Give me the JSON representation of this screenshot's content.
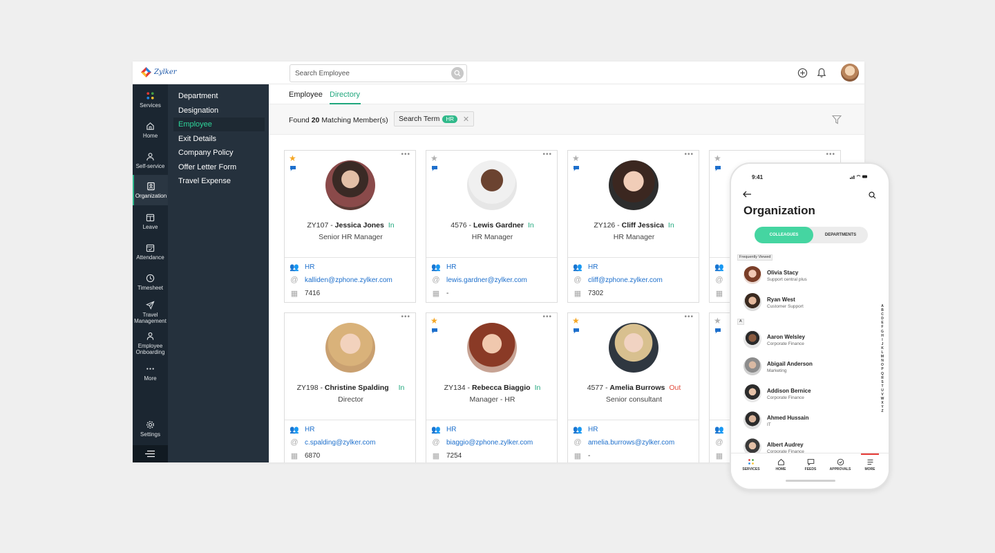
{
  "app": {
    "logo_text": "Zylker"
  },
  "search": {
    "placeholder": "Search Employee"
  },
  "rail": {
    "items": [
      {
        "label": "Services"
      },
      {
        "label": "Home"
      },
      {
        "label": "Self-service"
      },
      {
        "label": "Organization"
      },
      {
        "label": "Leave"
      },
      {
        "label": "Attendance"
      },
      {
        "label": "Timesheet"
      },
      {
        "label": "Travel Management"
      },
      {
        "label": "Employee Onboarding"
      },
      {
        "label": "More"
      },
      {
        "label": "Settings"
      }
    ]
  },
  "submenu": {
    "items": [
      {
        "label": "Department"
      },
      {
        "label": "Designation"
      },
      {
        "label": "Employee"
      },
      {
        "label": "Exit Details"
      },
      {
        "label": "Company Policy"
      },
      {
        "label": "Offer Letter Form"
      },
      {
        "label": "Travel Expense"
      }
    ]
  },
  "tabs": [
    {
      "label": "Employee"
    },
    {
      "label": "Directory"
    }
  ],
  "filter": {
    "found_prefix": "Found",
    "found_count": "20",
    "found_suffix": "Matching Member(s)",
    "chip_label": "Search Term",
    "chip_value": "HR"
  },
  "colors": {
    "accent": "#20a77d",
    "link": "#1d6fcc",
    "sidebar": "#1b2631",
    "submenu": "#25313d",
    "out": "#e24c3c",
    "star": "#f5a623"
  },
  "cards": [
    {
      "id": "ZY107",
      "name": "Jessica Jones",
      "status": "In",
      "role": "Senior HR Manager",
      "dept": "HR",
      "email": "kalliden@zphone.zylker.com",
      "ext": "7416",
      "starred": true
    },
    {
      "id": "4576",
      "name": "Lewis Gardner",
      "status": "In",
      "role": "HR Manager",
      "dept": "HR",
      "email": "lewis.gardner@zylker.com",
      "ext": "-",
      "starred": false
    },
    {
      "id": "ZY126",
      "name": "Cliff Jessica",
      "status": "In",
      "role": "HR Manager",
      "dept": "HR",
      "email": "cliff@zphone.zylker.com",
      "ext": "7302",
      "starred": false
    },
    {
      "id": "",
      "name": "",
      "status": "",
      "role": "",
      "dept": "",
      "email": "",
      "ext": "",
      "starred": false
    },
    {
      "id": "ZY198",
      "name": "Christine Spalding",
      "status": "In",
      "role": "Director",
      "dept": "HR",
      "email": "c.spalding@zylker.com",
      "ext": "6870",
      "starred": false
    },
    {
      "id": "ZY134",
      "name": "Rebecca Biaggio",
      "status": "In",
      "role": "Manager - HR",
      "dept": "HR",
      "email": "biaggio@zphone.zylker.com",
      "ext": "7254",
      "starred": true
    },
    {
      "id": "4577",
      "name": "Amelia Burrows",
      "status": "Out",
      "role": "Senior consultant",
      "dept": "HR",
      "email": "amelia.burrows@zylker.com",
      "ext": "-",
      "starred": true
    },
    {
      "id": "",
      "name": "",
      "status": "",
      "role": "",
      "dept": "",
      "email": "",
      "ext": "",
      "starred": false
    }
  ],
  "phone": {
    "time": "9:41",
    "title": "Organization",
    "seg_colleagues": "COLLEAGUES",
    "seg_departments": "DEPARTMENTS",
    "section_frequent": "Frequently Viewed",
    "section_a": "A",
    "frequent": [
      {
        "name": "Olivia Stacy",
        "sub": "Support central plus"
      },
      {
        "name": "Ryan West",
        "sub": "Customer Support"
      }
    ],
    "people": [
      {
        "name": "Aaron Welsley",
        "sub": "Corporate Finance"
      },
      {
        "name": "Abigail Anderson",
        "sub": "Marketing"
      },
      {
        "name": "Addison Bernice",
        "sub": "Corporate Finance"
      },
      {
        "name": "Ahmed Hussain",
        "sub": "IT"
      },
      {
        "name": "Albert Audrey",
        "sub": "Corporate Finance"
      }
    ],
    "alphabet": "A B C D E F G H I J K L M N O P Q R S T U V W X Y Z",
    "nav": [
      {
        "label": "SERVICES"
      },
      {
        "label": "HOME"
      },
      {
        "label": "FEEDS"
      },
      {
        "label": "APPROVALS"
      },
      {
        "label": "MORE"
      }
    ]
  }
}
